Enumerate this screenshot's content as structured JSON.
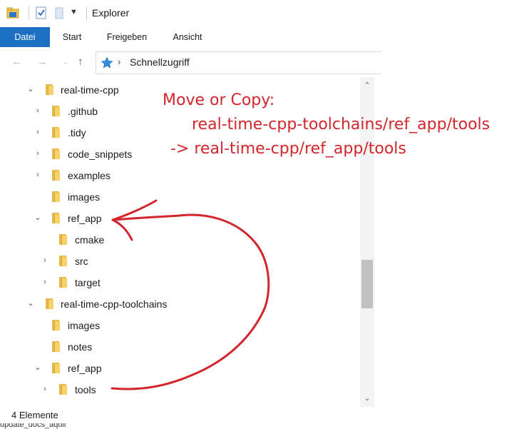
{
  "window": {
    "title": "Explorer"
  },
  "ribbon": {
    "tabs": [
      "Datei",
      "Start",
      "Freigeben",
      "Ansicht"
    ]
  },
  "address_bar": {
    "path": "Schnellzugriff"
  },
  "tree": [
    {
      "label": "real-time-cpp",
      "expander": "expanded"
    },
    {
      "label": ".github",
      "expander": "collapsed"
    },
    {
      "label": ".tidy",
      "expander": "collapsed"
    },
    {
      "label": "code_snippets",
      "expander": "collapsed"
    },
    {
      "label": "examples",
      "expander": "collapsed"
    },
    {
      "label": "images",
      "expander": "none"
    },
    {
      "label": "ref_app",
      "expander": "expanded"
    },
    {
      "label": "cmake",
      "expander": "none"
    },
    {
      "label": "src",
      "expander": "collapsed"
    },
    {
      "label": "target",
      "expander": "collapsed"
    },
    {
      "label": "real-time-cpp-toolchains",
      "expander": "expanded"
    },
    {
      "label": "images",
      "expander": "none"
    },
    {
      "label": "notes",
      "expander": "none"
    },
    {
      "label": "ref_app",
      "expander": "expanded"
    },
    {
      "label": "tools",
      "expander": "collapsed"
    }
  ],
  "status_bar": {
    "item_count": "4 Elemente"
  },
  "annotation": {
    "line1": "Move or Copy:",
    "line2": "real-time-cpp-toolchains/ref_app/tools",
    "line3": "-> real-time-cpp/ref_app/tools",
    "color": "#d3262c"
  },
  "colors": {
    "file_tab": "#1d6fc4",
    "folder": "#f5d26a"
  }
}
